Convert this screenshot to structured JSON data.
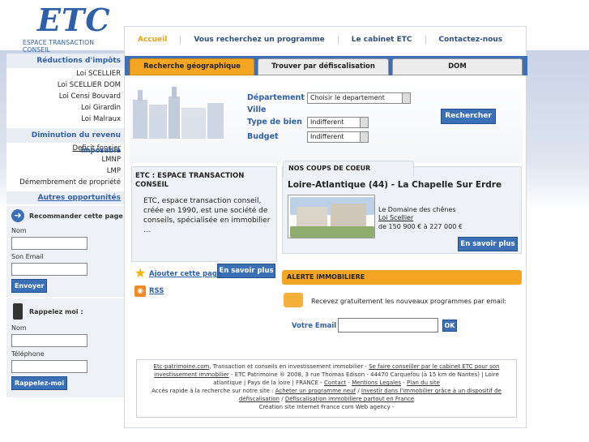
{
  "logo": {
    "mark": "ETC",
    "tagline": "ESPACE TRANSACTION CONSEIL"
  },
  "nav": [
    "Accueil",
    "Vous recherchez un programme",
    "Le cabinet ETC",
    "Contactez-nous"
  ],
  "sidebar": {
    "section1": "Réductions d'impôts",
    "items1": [
      "Loi SCELLIER",
      "Loi SCELLIER DOM",
      "Loi Censi Bouvard",
      "Loi Girardin",
      "Loi Malraux"
    ],
    "section2": "Diminution du revenu",
    "overlap_a": "Deficit foncier",
    "overlap_b": "imposable",
    "items2": [
      "LMNP",
      "LMP",
      "Démembrement de propriété"
    ],
    "more_link": "Autres opportunités",
    "recommend_title": "Recommander cette page",
    "nom_label": "Nom",
    "email_label": "Son Email",
    "send_button": "Envoyer",
    "callback_title": "Rappelez moi :",
    "nom_label2": "Nom",
    "phone_label": "Téléphone",
    "callback_button": "Rappelez-moi"
  },
  "tabs": [
    "Recherche géographique",
    "Trouver par défiscalisation",
    "DOM"
  ],
  "search": {
    "departement_label": "Département",
    "departement_value": "Choisir le departement",
    "ville_label": "Ville",
    "type_label": "Type de bien",
    "type_value": "Indifferent",
    "budget_label": "Budget",
    "budget_value": "Indifferent",
    "submit": "Rechercher"
  },
  "etc_box": {
    "title": "ETC : ESPACE TRANSACTION CONSEIL",
    "text": "ETC, espace transaction conseil, créée en 1990, est une société de conseils, spécialisée en immobilier ...",
    "more": "En savoir plus"
  },
  "coeur": {
    "tab": "NOS COUPS DE COEUR",
    "location": "Loire-Atlantique (44) - La Chapelle Sur Erdre",
    "residence": "Le Domaine des chênes",
    "law": "Loi Scellier",
    "price": "de 150 900 € à 227 000 €",
    "more": "En savoir plus"
  },
  "quicklinks": {
    "add": "Ajouter cette page",
    "rss": "RSS"
  },
  "alert": {
    "title": "ALERTE IMMOBILIERE",
    "text": "Recevez gratuitement les nouveaux programmes par email:",
    "email_label": "Votre Email",
    "ok": "OK"
  },
  "footer": {
    "line1a": "Etc-patrimoine.com",
    "line1b": ", Transaction et conseils en investissement immobilier - ",
    "line1c": "Se faire conseiller par le cabinet ETC pour son investissement immobilier",
    "line1d": " - ETC Patrimoine ® 2008, 3 rue Thomas Edison - 44470 Carquefou (à 15 km de Nantes) | Loire atlantique | Pays de la loire | FRANCE - ",
    "contact": "Contact",
    "sep": " - ",
    "mentions": "Mentions Legales",
    "sep2": " - ",
    "plan": "Plan du site",
    "line2a": "Accès rapide à la recherche sur notre site : ",
    "line2b": "Acheter un programme neuf",
    "line2c": " / ",
    "line2d": "Investir dans l'immobilier grâce à un dispositif de défiscalisation",
    "line2e": " / ",
    "line2f": "Défiscalisation immobiliere partout en France",
    "line3": "Création site Internet France com Web agency -"
  },
  "colors": {
    "brand_blue": "#2f5fa8",
    "button_blue": "#3b6fb6",
    "orange": "#f4a623"
  }
}
